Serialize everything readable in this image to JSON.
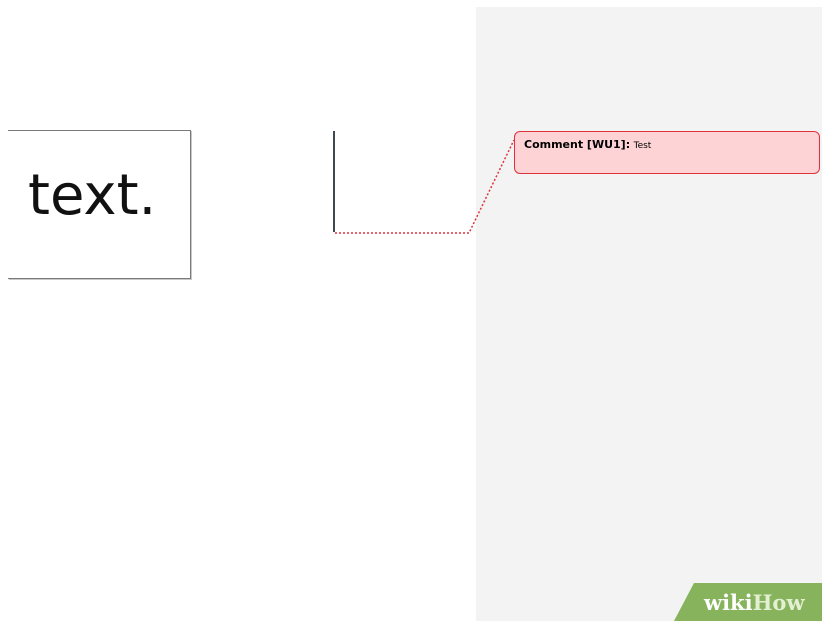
{
  "document": {
    "text_box": {
      "content": "text."
    }
  },
  "comment": {
    "label": "Comment [WU1]:",
    "text": "Test",
    "colors": {
      "fill": "#fdd3d5",
      "border": "#e0323c",
      "connector": "#e0323c"
    }
  },
  "markup_pane": {
    "background": "#f3f3f3"
  },
  "watermark": {
    "part1": "wiki",
    "part2": "How",
    "background": "#86b35c"
  }
}
